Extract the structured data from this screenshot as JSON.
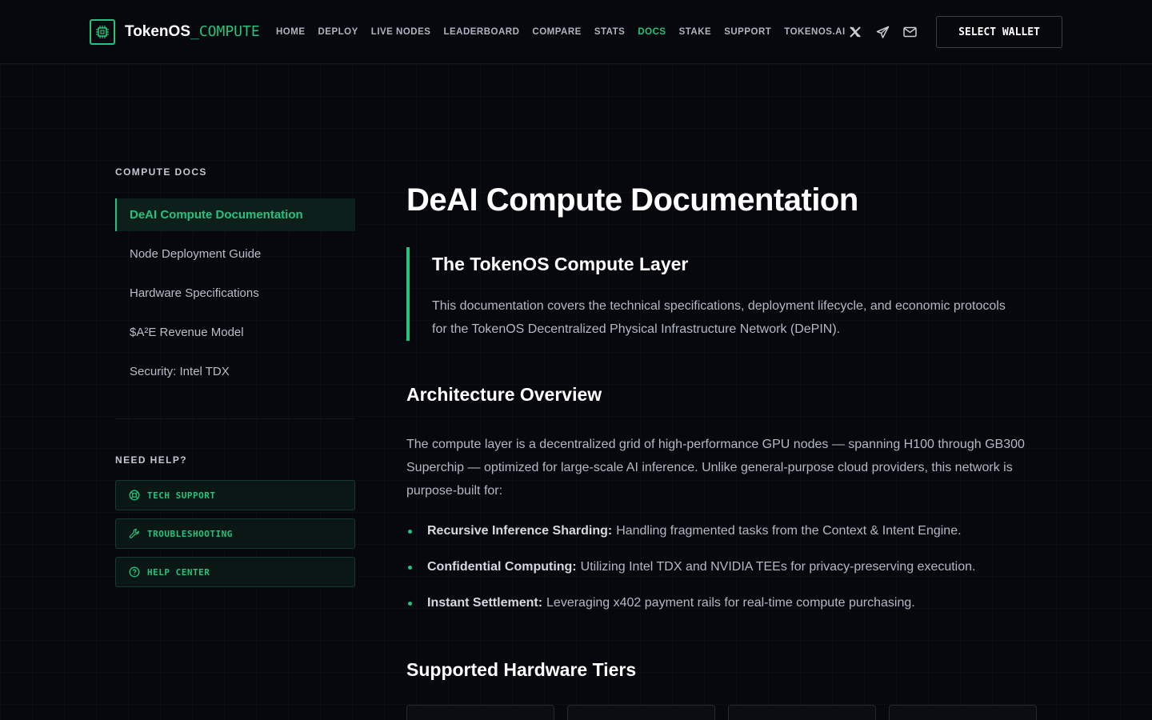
{
  "header": {
    "logo_text": "TokenOS",
    "logo_accent": "_COMPUTE",
    "nav": [
      {
        "label": "HOME"
      },
      {
        "label": "DEPLOY"
      },
      {
        "label": "LIVE NODES"
      },
      {
        "label": "LEADERBOARD"
      },
      {
        "label": "COMPARE"
      },
      {
        "label": "STATS"
      },
      {
        "label": "DOCS",
        "active": true
      },
      {
        "label": "STAKE"
      },
      {
        "label": "SUPPORT"
      },
      {
        "label": "TOKENOS.AI"
      }
    ],
    "social_icons": [
      "x-icon",
      "telegram-icon",
      "mail-icon"
    ],
    "wallet_button": "SELECT WALLET"
  },
  "sidebar": {
    "heading": "COMPUTE DOCS",
    "items": [
      {
        "label": "DeAI Compute Documentation",
        "active": true
      },
      {
        "label": "Node Deployment Guide"
      },
      {
        "label": "Hardware Specifications"
      },
      {
        "label": "$A²E Revenue Model"
      },
      {
        "label": "Security: Intel TDX"
      }
    ],
    "help_heading": "NEED HELP?",
    "help_buttons": [
      {
        "label": "TECH SUPPORT",
        "icon": "lifebuoy-icon"
      },
      {
        "label": "TROUBLESHOOTING",
        "icon": "wrench-icon"
      },
      {
        "label": "HELP CENTER",
        "icon": "help-circle-icon"
      }
    ]
  },
  "main": {
    "title": "DeAI Compute Documentation",
    "callout": {
      "title": "The TokenOS Compute Layer",
      "text": "This documentation covers the technical specifications, deployment lifecycle, and economic protocols for the TokenOS Decentralized Physical Infrastructure Network (DePIN)."
    },
    "architecture": {
      "heading": "Architecture Overview",
      "paragraph": "The compute layer is a decentralized grid of high-performance GPU nodes — spanning H100 through GB300 Superchip — optimized for large-scale AI inference. Unlike general-purpose cloud providers, this network is purpose-built for:",
      "bullets": [
        {
          "bold": "Recursive Inference Sharding:",
          "text": "Handling fragmented tasks from the Context & Intent Engine."
        },
        {
          "bold": "Confidential Computing:",
          "text": "Utilizing Intel TDX and NVIDIA TEEs for privacy-preserving execution."
        },
        {
          "bold": "Instant Settlement:",
          "text": "Leveraging x402 payment rails for real-time compute purchasing."
        }
      ]
    },
    "hardware_heading": "Supported Hardware Tiers"
  },
  "colors": {
    "accent": "#22c47e",
    "background": "#07080d"
  }
}
